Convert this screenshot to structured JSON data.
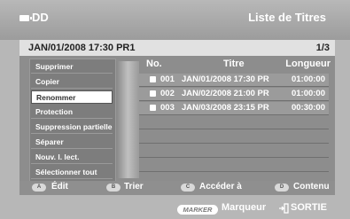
{
  "header": {
    "device_label": "DD",
    "screen_title": "Liste de Titres"
  },
  "info": {
    "datetime": "JAN/01/2008 17:30 PR1",
    "page": "1/3"
  },
  "table": {
    "columns": {
      "no": "No.",
      "title": "Titre",
      "length": "Longueur"
    },
    "rows": [
      {
        "no": "001",
        "title": "JAN/01/2008 17:30 PR",
        "length": "01:00:00"
      },
      {
        "no": "002",
        "title": "JAN/02/2008 21:00 PR",
        "length": "01:00:00"
      },
      {
        "no": "003",
        "title": "JAN/03/2008 23:15 PR",
        "length": "00:30:00"
      }
    ]
  },
  "menu": {
    "items": [
      "Supprimer",
      "Copier",
      "Renommer",
      "Protection",
      "Suppression partielle",
      "Séparer",
      "Nouv. l. lect.",
      "Sélectionner tout"
    ],
    "selected": "Renommer"
  },
  "legend": {
    "a": {
      "key": "A",
      "label": "Édit"
    },
    "b": {
      "key": "B",
      "label": "Trier"
    },
    "c": {
      "key": "C",
      "label": "Accéder à"
    },
    "d": {
      "key": "D",
      "label": "Contenu"
    }
  },
  "footer": {
    "marker_key": "MARKER",
    "marker_label": "Marqueur",
    "exit_label": "SORTIE"
  },
  "colors": {
    "background": "#b7b7b7",
    "panel": "#8d8d8d",
    "selected_item": "#ffffff"
  }
}
